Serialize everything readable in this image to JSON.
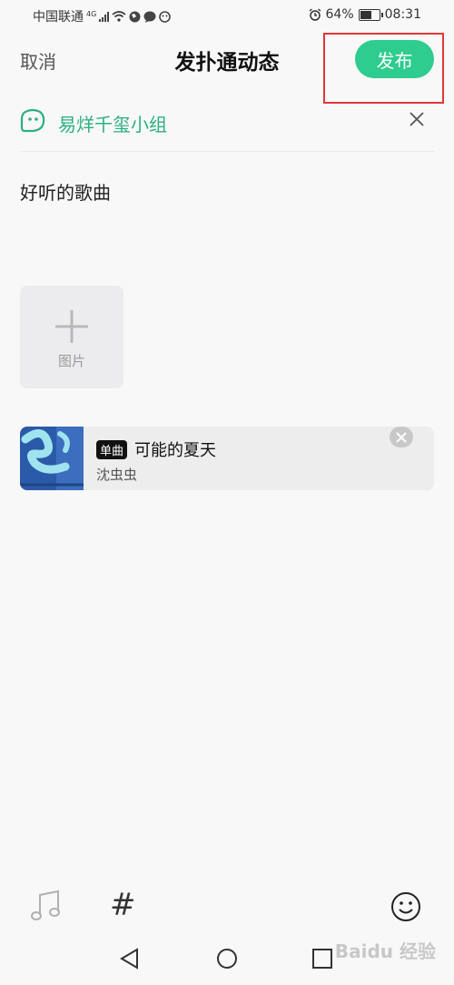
{
  "status": {
    "carrier": "中国联通",
    "network": "4G",
    "battery_percent": "64%",
    "battery_level": 0.64,
    "time": "08:31"
  },
  "header": {
    "cancel_label": "取消",
    "title": "发扑通动态",
    "publish_label": "发布"
  },
  "group": {
    "name": "易烊千玺小组"
  },
  "post": {
    "text": "好听的歌曲"
  },
  "image_picker": {
    "label": "图片"
  },
  "music": {
    "badge": "单曲",
    "title": "可能的夏天",
    "artist": "沈虫虫"
  },
  "toolbar": {
    "topic_symbol": "#"
  },
  "watermark": "Baidu 经验",
  "colors": {
    "accent": "#2ecc8e",
    "group_text": "#2bb07e",
    "highlight": "#e0373b"
  },
  "icons": [
    "music-note-icon",
    "hashtag-icon",
    "emoji-icon",
    "close-icon",
    "plus-icon",
    "group-icon",
    "back-icon",
    "home-icon",
    "recent-apps-icon"
  ]
}
